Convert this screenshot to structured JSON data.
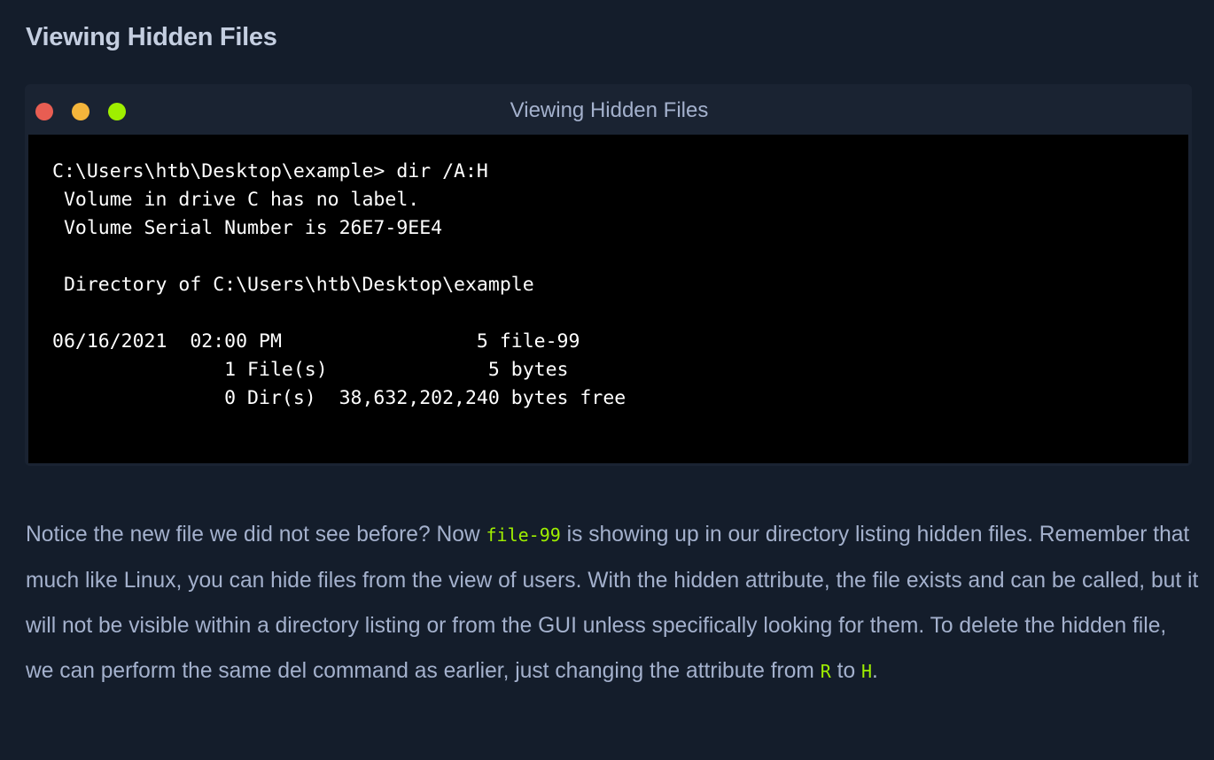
{
  "heading": "Viewing Hidden Files",
  "terminal": {
    "title": "Viewing Hidden Files",
    "lines": [
      "C:\\Users\\htb\\Desktop\\example> dir /A:H",
      " Volume in drive C has no label.",
      " Volume Serial Number is 26E7-9EE4",
      "",
      " Directory of C:\\Users\\htb\\Desktop\\example",
      "",
      "06/16/2021  02:00 PM                 5 file-99",
      "               1 File(s)              5 bytes",
      "               0 Dir(s)  38,632,202,240 bytes free"
    ],
    "controls": [
      "close",
      "minimize",
      "maximize"
    ]
  },
  "paragraph": {
    "part1": "Notice the new file we did not see before? Now ",
    "code1": "file-99",
    "part2": " is showing up in our directory listing hidden files. Remember that much like Linux, you can hide files from the view of users. With the hidden attribute, the file exists and can be called, but it will not be visible within a directory listing or from the GUI unless specifically looking for them. To delete the hidden file, we can perform the same del command as earlier, just changing the attribute from ",
    "code2": "R",
    "part3": " to ",
    "code3": "H",
    "part4": "."
  },
  "colors": {
    "background": "#141d2b",
    "window": "#1a2332",
    "terminal": "#000000",
    "accent": "#9fef00",
    "text": "#a4b1cd",
    "close": "#e85d52",
    "minimize": "#f4b53b",
    "maximize": "#9fef00"
  }
}
